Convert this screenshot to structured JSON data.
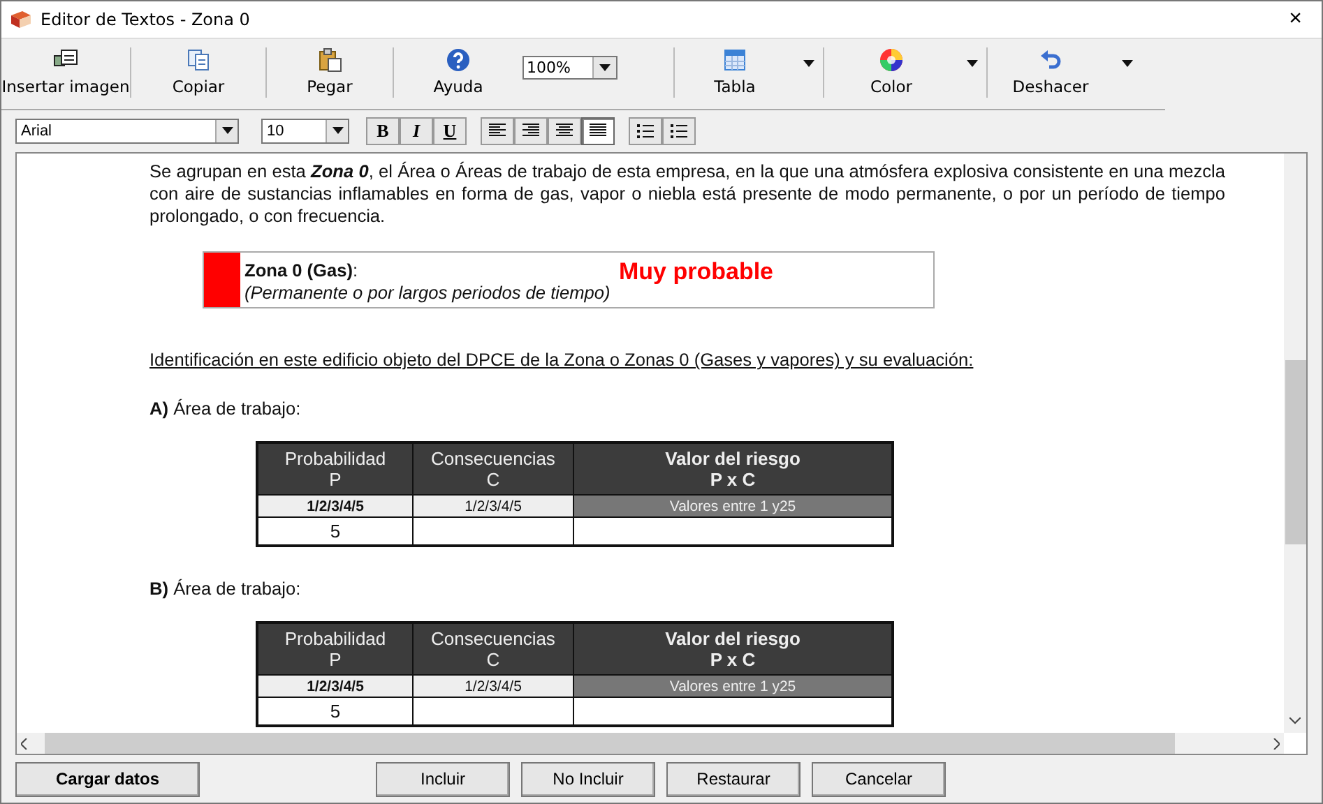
{
  "window": {
    "title": "Editor de Textos - Zona 0",
    "close": "×"
  },
  "toolbar": {
    "items": [
      {
        "kind": "button",
        "label": "Insertar imagen"
      },
      {
        "kind": "button",
        "label": "Copiar"
      },
      {
        "kind": "button",
        "label": "Pegar"
      },
      {
        "kind": "button",
        "label": "Ayuda"
      },
      {
        "kind": "combo",
        "value": "100%"
      },
      {
        "kind": "split",
        "label": "Tabla"
      },
      {
        "kind": "split",
        "label": "Color"
      },
      {
        "kind": "split",
        "label": "Deshacer"
      }
    ]
  },
  "format": {
    "font": "Arial",
    "size": "10",
    "styles": [
      "B",
      "I",
      "U"
    ],
    "align": [
      {
        "selected": false
      },
      {
        "selected": false
      },
      {
        "selected": false
      },
      {
        "selected": true
      }
    ]
  },
  "document": {
    "paragraph": "Se agrupan en esta **Zona 0**, el Área o Áreas de trabajo de esta empresa, en la que una atmósfera explosiva consistente en una mezcla con aire de sustancias inflamables en forma de gas, vapor o niebla está presente de modo permanente, o por un período de tiempo prolongado, o con frecuencia.",
    "zone": {
      "title": "**Zona 0 (Gas)**:",
      "subtitle": "(Permanente o por largos periodos de tiempo)",
      "probability": "Muy probable",
      "color": "#ff0000"
    },
    "heading": "Identificación en este edificio objeto del DPCE de la Zona o Zonas 0 (Gases y vapores) y su evaluación:",
    "sections": [
      {
        "label": "**A)** Área de trabajo:",
        "table": {
          "columns": [
            {
              "title": "Probabilidad",
              "sub": "P"
            },
            {
              "title": "Consecuencias",
              "sub": "C"
            },
            {
              "title": "Valor del riesgo",
              "sub": "P x C"
            }
          ],
          "ranges": [
            "1/2/3/4/5",
            "1/2/3/4/5",
            "Valores entre 1 y25"
          ],
          "values": [
            "5"
          ]
        }
      },
      {
        "label": "**B)** Área de trabajo:",
        "table": {
          "columns": [
            {
              "title": "Probabilidad",
              "sub": "P"
            },
            {
              "title": "Consecuencias",
              "sub": "C"
            },
            {
              "title": "Valor del riesgo",
              "sub": "P x C"
            }
          ],
          "ranges": [
            "1/2/3/4/5",
            "1/2/3/4/5",
            "Valores entre 1 y25"
          ],
          "values": [
            "5"
          ]
        }
      }
    ]
  },
  "footer": {
    "primary": "Cargar datos",
    "buttons": [
      "Incluir",
      "No Incluir",
      "Restaurar",
      "Cancelar"
    ]
  }
}
